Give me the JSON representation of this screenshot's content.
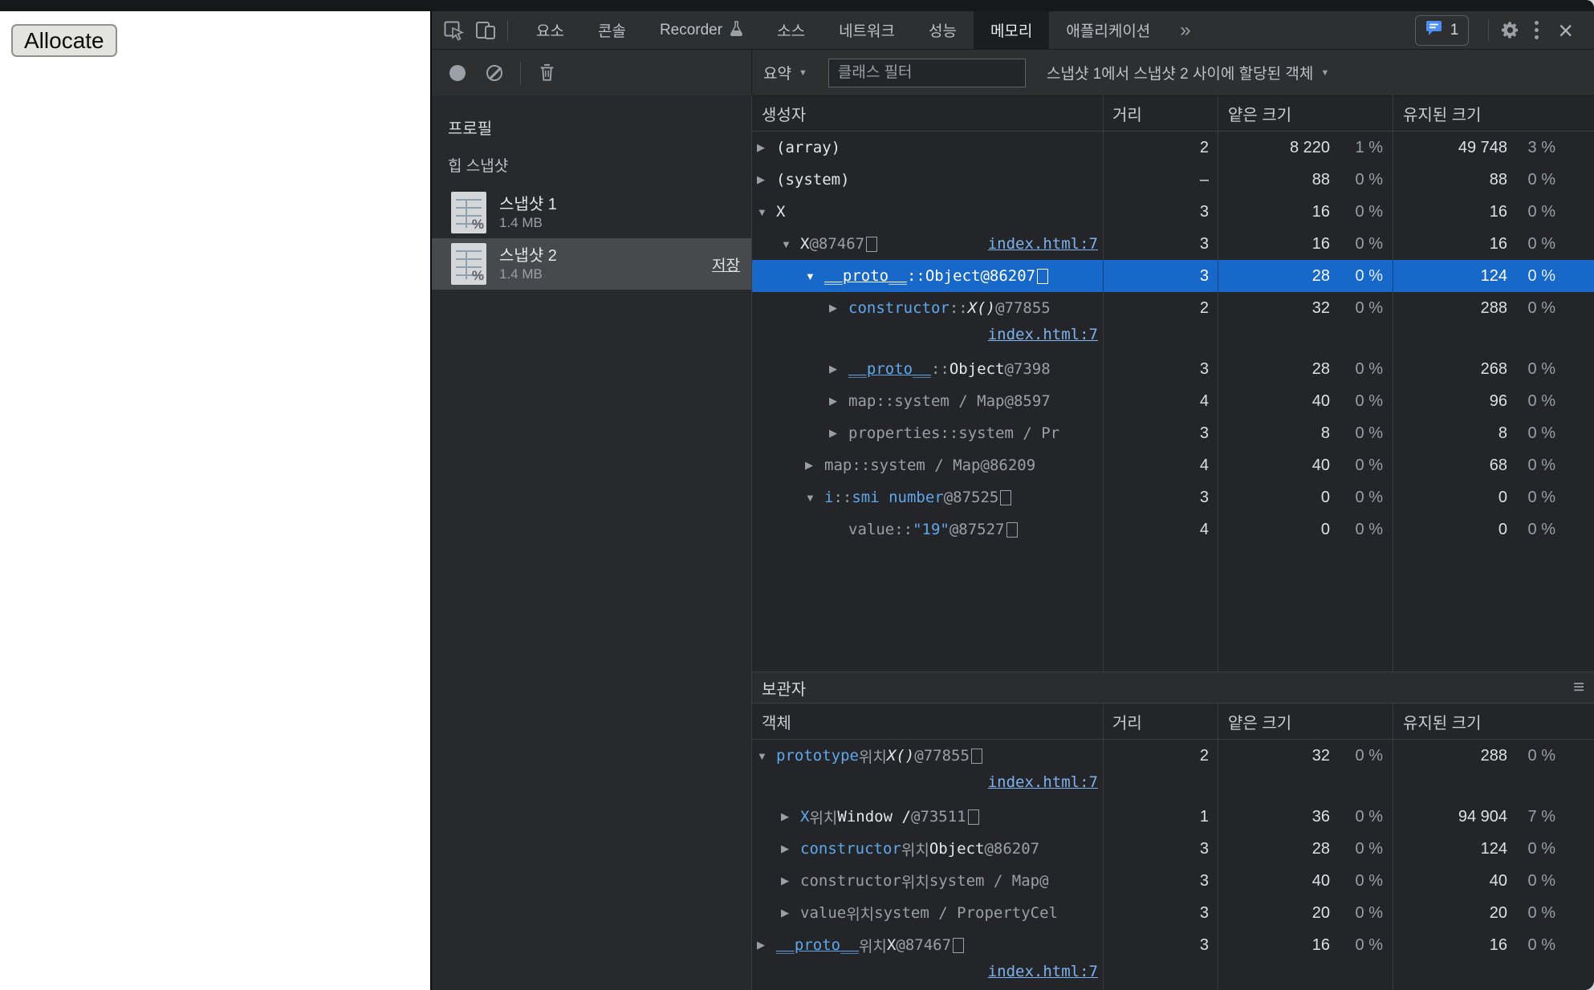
{
  "page": {
    "allocate_button": "Allocate"
  },
  "devtools": {
    "colors": {
      "selection_blue": "#1768c9",
      "property_blue": "#5fa8ec",
      "link_blue": "#7db2ee",
      "muted_gray": "#9aa0a6",
      "issues_blue": "#4c8df6"
    },
    "tabs": {
      "items": [
        {
          "label": "요소"
        },
        {
          "label": "콘솔"
        },
        {
          "label": "Recorder",
          "icon": "flask"
        },
        {
          "label": "소스"
        },
        {
          "label": "네트워크"
        },
        {
          "label": "성능"
        },
        {
          "label": "메모리",
          "selected": true
        },
        {
          "label": "애플리케이션"
        }
      ],
      "overflow": "»",
      "issues_count": "1"
    },
    "toolbar": {
      "summary_label": "요약",
      "filter_placeholder": "클래스 필터",
      "allocation_filter": "스냅샷 1에서 스냅샷 2 사이에 할당된 객체"
    },
    "sidebar": {
      "profiles_label": "프로필",
      "group_label": "힙 스냅샷",
      "save_label": "저장",
      "items": [
        {
          "name": "스냅샷 1",
          "size": "1.4 MB",
          "selected": false
        },
        {
          "name": "스냅샷 2",
          "size": "1.4 MB",
          "selected": true
        }
      ]
    },
    "constructors": {
      "columns": {
        "name": "생성자",
        "distance": "거리",
        "shallow": "얕은 크기",
        "retained": "유지된 크기"
      },
      "rows": [
        {
          "indent": 0,
          "arrow": "closed",
          "segments": [
            [
              "(array)",
              "plain"
            ]
          ],
          "distance": "2",
          "shallow": "8 220",
          "shallow_pct": "1 %",
          "retained": "49 748",
          "retained_pct": "3 %"
        },
        {
          "indent": 0,
          "arrow": "closed",
          "segments": [
            [
              "(system)",
              "plain"
            ]
          ],
          "distance": "–",
          "shallow": "88",
          "shallow_pct": "0 %",
          "retained": "88",
          "retained_pct": "0 %"
        },
        {
          "indent": 0,
          "arrow": "open",
          "segments": [
            [
              "X",
              "plain"
            ]
          ],
          "distance": "3",
          "shallow": "16",
          "shallow_pct": "0 %",
          "retained": "16",
          "retained_pct": "0 %"
        },
        {
          "indent": 1,
          "arrow": "open",
          "segments": [
            [
              "X",
              "plain"
            ],
            [
              " @87467 ",
              "id"
            ],
            [
              "",
              "box"
            ]
          ],
          "inline_link": "index.html:7",
          "distance": "3",
          "shallow": "16",
          "shallow_pct": "0 %",
          "retained": "16",
          "retained_pct": "0 %"
        },
        {
          "indent": 2,
          "arrow": "open",
          "selected": true,
          "segments": [
            [
              "__proto__",
              "prop-u"
            ],
            [
              " :: ",
              "sep"
            ],
            [
              "Object",
              "plain"
            ],
            [
              " @86207 ",
              "id"
            ],
            [
              "",
              "box"
            ]
          ],
          "distance": "3",
          "shallow": "28",
          "shallow_pct": "0 %",
          "retained": "124",
          "retained_pct": "0 %"
        },
        {
          "indent": 3,
          "arrow": "closed",
          "segments": [
            [
              "constructor",
              "prop"
            ],
            [
              " :: ",
              "sep"
            ],
            [
              "X()",
              "fn"
            ],
            [
              " @77855",
              "id"
            ]
          ],
          "second_line_link": "index.html:7",
          "distance": "2",
          "shallow": "32",
          "shallow_pct": "0 %",
          "retained": "288",
          "retained_pct": "0 %"
        },
        {
          "indent": 3,
          "arrow": "closed",
          "segments": [
            [
              "__proto__",
              "prop-u"
            ],
            [
              " :: ",
              "sep"
            ],
            [
              "Object",
              "plain"
            ],
            [
              " @7398",
              "id"
            ]
          ],
          "distance": "3",
          "shallow": "28",
          "shallow_pct": "0 %",
          "retained": "268",
          "retained_pct": "0 %"
        },
        {
          "indent": 3,
          "arrow": "closed",
          "segments": [
            [
              "map",
              "sys"
            ],
            [
              " :: ",
              "sep"
            ],
            [
              "system / Map",
              "sysval"
            ],
            [
              " @8597",
              "id"
            ]
          ],
          "distance": "4",
          "shallow": "40",
          "shallow_pct": "0 %",
          "retained": "96",
          "retained_pct": "0 %"
        },
        {
          "indent": 3,
          "arrow": "closed",
          "segments": [
            [
              "properties",
              "sys"
            ],
            [
              " :: ",
              "sep"
            ],
            [
              "system / Pr",
              "sysval"
            ]
          ],
          "distance": "3",
          "shallow": "8",
          "shallow_pct": "0 %",
          "retained": "8",
          "retained_pct": "0 %"
        },
        {
          "indent": 2,
          "arrow": "closed",
          "segments": [
            [
              "map",
              "sys"
            ],
            [
              " :: ",
              "sep"
            ],
            [
              "system / Map",
              "sysval"
            ],
            [
              " @86209",
              "id"
            ]
          ],
          "distance": "4",
          "shallow": "40",
          "shallow_pct": "0 %",
          "retained": "68",
          "retained_pct": "0 %"
        },
        {
          "indent": 2,
          "arrow": "open",
          "segments": [
            [
              "i",
              "prop"
            ],
            [
              " :: ",
              "sep"
            ],
            [
              "smi number",
              "type"
            ],
            [
              " @87525 ",
              "id"
            ],
            [
              "",
              "box"
            ]
          ],
          "distance": "3",
          "shallow": "0",
          "shallow_pct": "0 %",
          "retained": "0",
          "retained_pct": "0 %"
        },
        {
          "indent": 3,
          "arrow": "none",
          "segments": [
            [
              "value",
              "sys"
            ],
            [
              " :: ",
              "sep"
            ],
            [
              "\"19\"",
              "str"
            ],
            [
              " @87527 ",
              "id"
            ],
            [
              "",
              "box"
            ]
          ],
          "distance": "4",
          "shallow": "0",
          "shallow_pct": "0 %",
          "retained": "0",
          "retained_pct": "0 %"
        }
      ]
    },
    "retainers": {
      "title": "보관자",
      "columns": {
        "name": "객체",
        "distance": "거리",
        "shallow": "얕은 크기",
        "retained": "유지된 크기"
      },
      "rows": [
        {
          "indent": 0,
          "arrow": "open",
          "segments": [
            [
              "prototype",
              "prop"
            ],
            [
              " 위치 ",
              "loc"
            ],
            [
              "X()",
              "fn"
            ],
            [
              " @77855 ",
              "id"
            ],
            [
              "",
              "box"
            ]
          ],
          "second_line_link": "index.html:7",
          "distance": "2",
          "shallow": "32",
          "shallow_pct": "0 %",
          "retained": "288",
          "retained_pct": "0 %"
        },
        {
          "indent": 1,
          "arrow": "closed",
          "segments": [
            [
              "X",
              "prop"
            ],
            [
              " 위치 ",
              "loc"
            ],
            [
              "Window /",
              "plain"
            ],
            [
              "  @73511 ",
              "id"
            ],
            [
              "",
              "box"
            ]
          ],
          "distance": "1",
          "shallow": "36",
          "shallow_pct": "0 %",
          "retained": "94 904",
          "retained_pct": "7 %"
        },
        {
          "indent": 1,
          "arrow": "closed",
          "segments": [
            [
              "constructor",
              "prop"
            ],
            [
              " 위치 ",
              "loc"
            ],
            [
              "Object",
              "plain"
            ],
            [
              " @86207",
              "id"
            ]
          ],
          "distance": "3",
          "shallow": "28",
          "shallow_pct": "0 %",
          "retained": "124",
          "retained_pct": "0 %"
        },
        {
          "indent": 1,
          "arrow": "closed",
          "segments": [
            [
              "constructor",
              "sys"
            ],
            [
              " 위치 ",
              "loc"
            ],
            [
              "system / Map",
              "sysval"
            ],
            [
              " @",
              "id"
            ]
          ],
          "distance": "3",
          "shallow": "40",
          "shallow_pct": "0 %",
          "retained": "40",
          "retained_pct": "0 %"
        },
        {
          "indent": 1,
          "arrow": "closed",
          "segments": [
            [
              "value",
              "sys"
            ],
            [
              " 위치 ",
              "loc"
            ],
            [
              "system / PropertyCel",
              "sysval"
            ]
          ],
          "distance": "3",
          "shallow": "20",
          "shallow_pct": "0 %",
          "retained": "20",
          "retained_pct": "0 %"
        },
        {
          "indent": 0,
          "arrow": "closed",
          "segments": [
            [
              "__proto__",
              "prop-u"
            ],
            [
              " 위치 ",
              "loc"
            ],
            [
              "X",
              "plain"
            ],
            [
              " @87467 ",
              "id"
            ],
            [
              "",
              "box"
            ]
          ],
          "second_line_link": "index.html:7",
          "distance": "3",
          "shallow": "16",
          "shallow_pct": "0 %",
          "retained": "16",
          "retained_pct": "0 %"
        }
      ]
    }
  }
}
